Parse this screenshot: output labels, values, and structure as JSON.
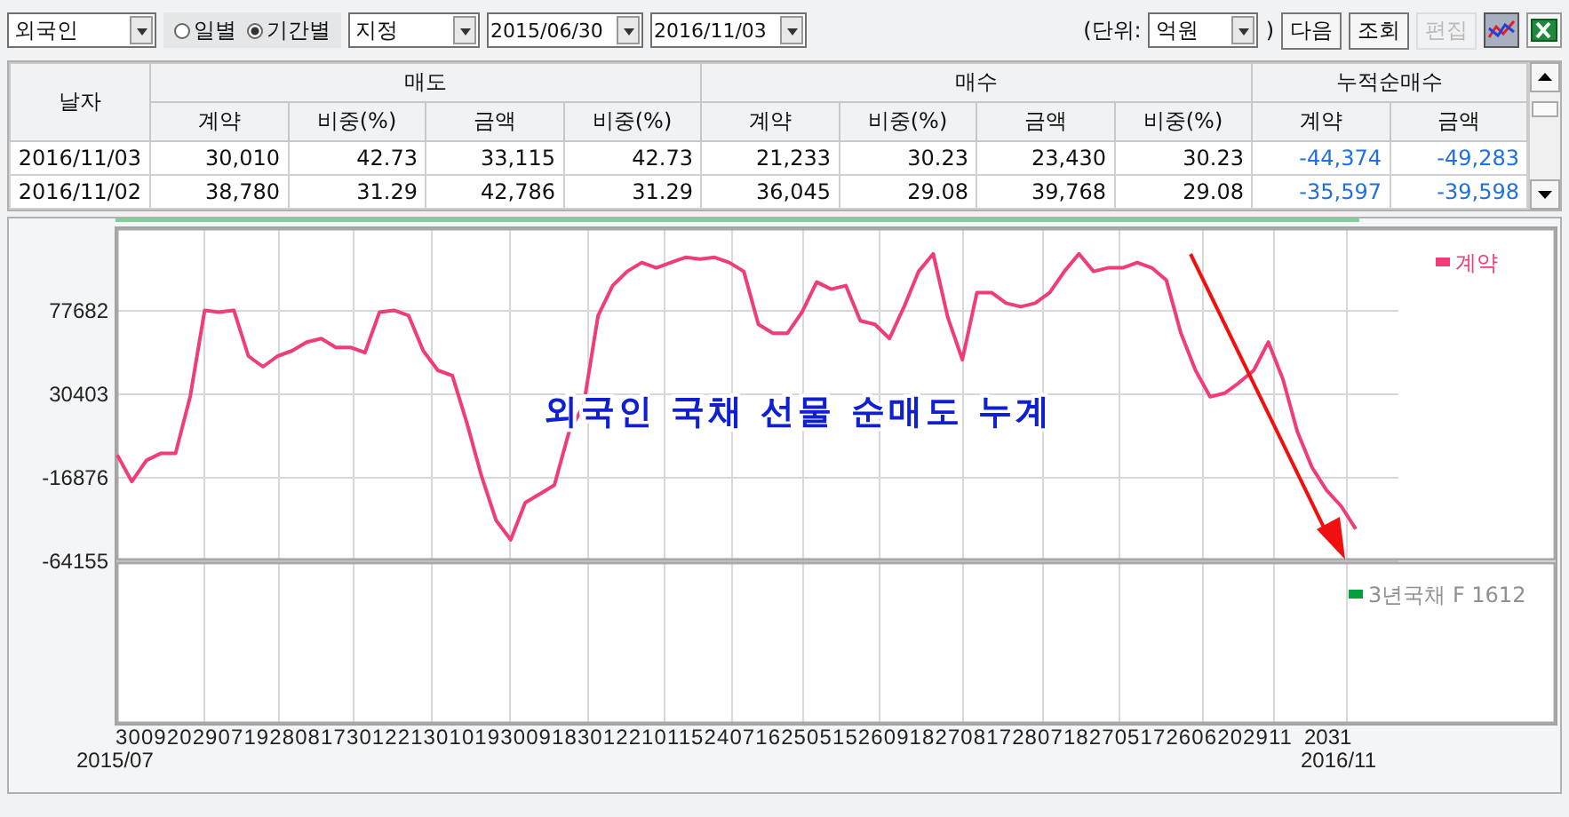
{
  "toolbar": {
    "investor_select": "외국인",
    "period_radios": [
      {
        "label": "일별",
        "selected": false
      },
      {
        "label": "기간별",
        "selected": true
      }
    ],
    "range_select": "지정",
    "start_date": "2015/06/30",
    "end_date": "2016/11/03",
    "unit_prefix": "(단위:",
    "unit_select": "억원",
    "unit_suffix": ")",
    "buttons": [
      {
        "label": "다음",
        "disabled": false
      },
      {
        "label": "조회",
        "disabled": false
      },
      {
        "label": "편집",
        "disabled": true
      }
    ],
    "chart_toggle": {
      "on": true
    }
  },
  "table": {
    "date_header": "날자",
    "groups": [
      {
        "label": "매도",
        "columns": [
          "계약",
          "비중(%)",
          "금액",
          "비중(%)"
        ]
      },
      {
        "label": "매수",
        "columns": [
          "계약",
          "비중(%)",
          "금액",
          "비중(%)"
        ]
      },
      {
        "label": "누적순매수",
        "columns": [
          "계약",
          "금액"
        ]
      }
    ],
    "rows": [
      {
        "date": "2016/11/03",
        "cells": [
          "30,010",
          "42.73",
          "33,115",
          "42.73",
          "21,233",
          "30.23",
          "23,430",
          "30.23",
          "-44,374",
          "-49,283"
        ]
      },
      {
        "date": "2016/11/02",
        "cells": [
          "38,780",
          "31.29",
          "42,786",
          "31.29",
          "36,045",
          "29.08",
          "39,768",
          "29.08",
          "-35,597",
          "-39,598"
        ]
      }
    ]
  },
  "chart": {
    "chart_data": {
      "type": "line",
      "grid": true,
      "yticks": [
        -64155,
        -16876,
        30403,
        77682
      ],
      "ylim": [
        -155710,
        123958
      ],
      "series": [
        {
          "name": "계약",
          "color": "#f03c78",
          "values": [
            -4000,
            -19000,
            -7000,
            -3000,
            -3000,
            29000,
            78000,
            77000,
            78000,
            52000,
            46000,
            52000,
            55000,
            60000,
            62000,
            57000,
            57000,
            54000,
            77000,
            78000,
            75000,
            55000,
            44000,
            41000,
            14000,
            -16000,
            -41000,
            -52000,
            -31000,
            -26000,
            -21000,
            9000,
            24000,
            75000,
            92000,
            100000,
            105000,
            102000,
            105000,
            108000,
            107000,
            108000,
            105000,
            100000,
            70000,
            65000,
            65000,
            77000,
            94000,
            90000,
            92000,
            72000,
            70000,
            62000,
            80000,
            100000,
            110000,
            74000,
            50000,
            88000,
            88000,
            82000,
            80000,
            82000,
            88000,
            100000,
            110000,
            100000,
            102000,
            102000,
            105000,
            102000,
            95000,
            65000,
            44000,
            29000,
            31000,
            37000,
            44000,
            60000,
            39000,
            9000,
            -11000,
            -24000,
            -33000,
            -46000
          ]
        }
      ]
    },
    "x_ticks_text": "30092029071928081730122130101930091830122101152407162505152609182708172807182705172606202911",
    "x_ticks_end": "2031",
    "start_label": "2015/07",
    "end_label": "2016/11",
    "lower_legend": {
      "label": "3년국채 F 1612",
      "color": "#00a040"
    },
    "annotation": "외국인 국채 선물 순매도 누계"
  }
}
